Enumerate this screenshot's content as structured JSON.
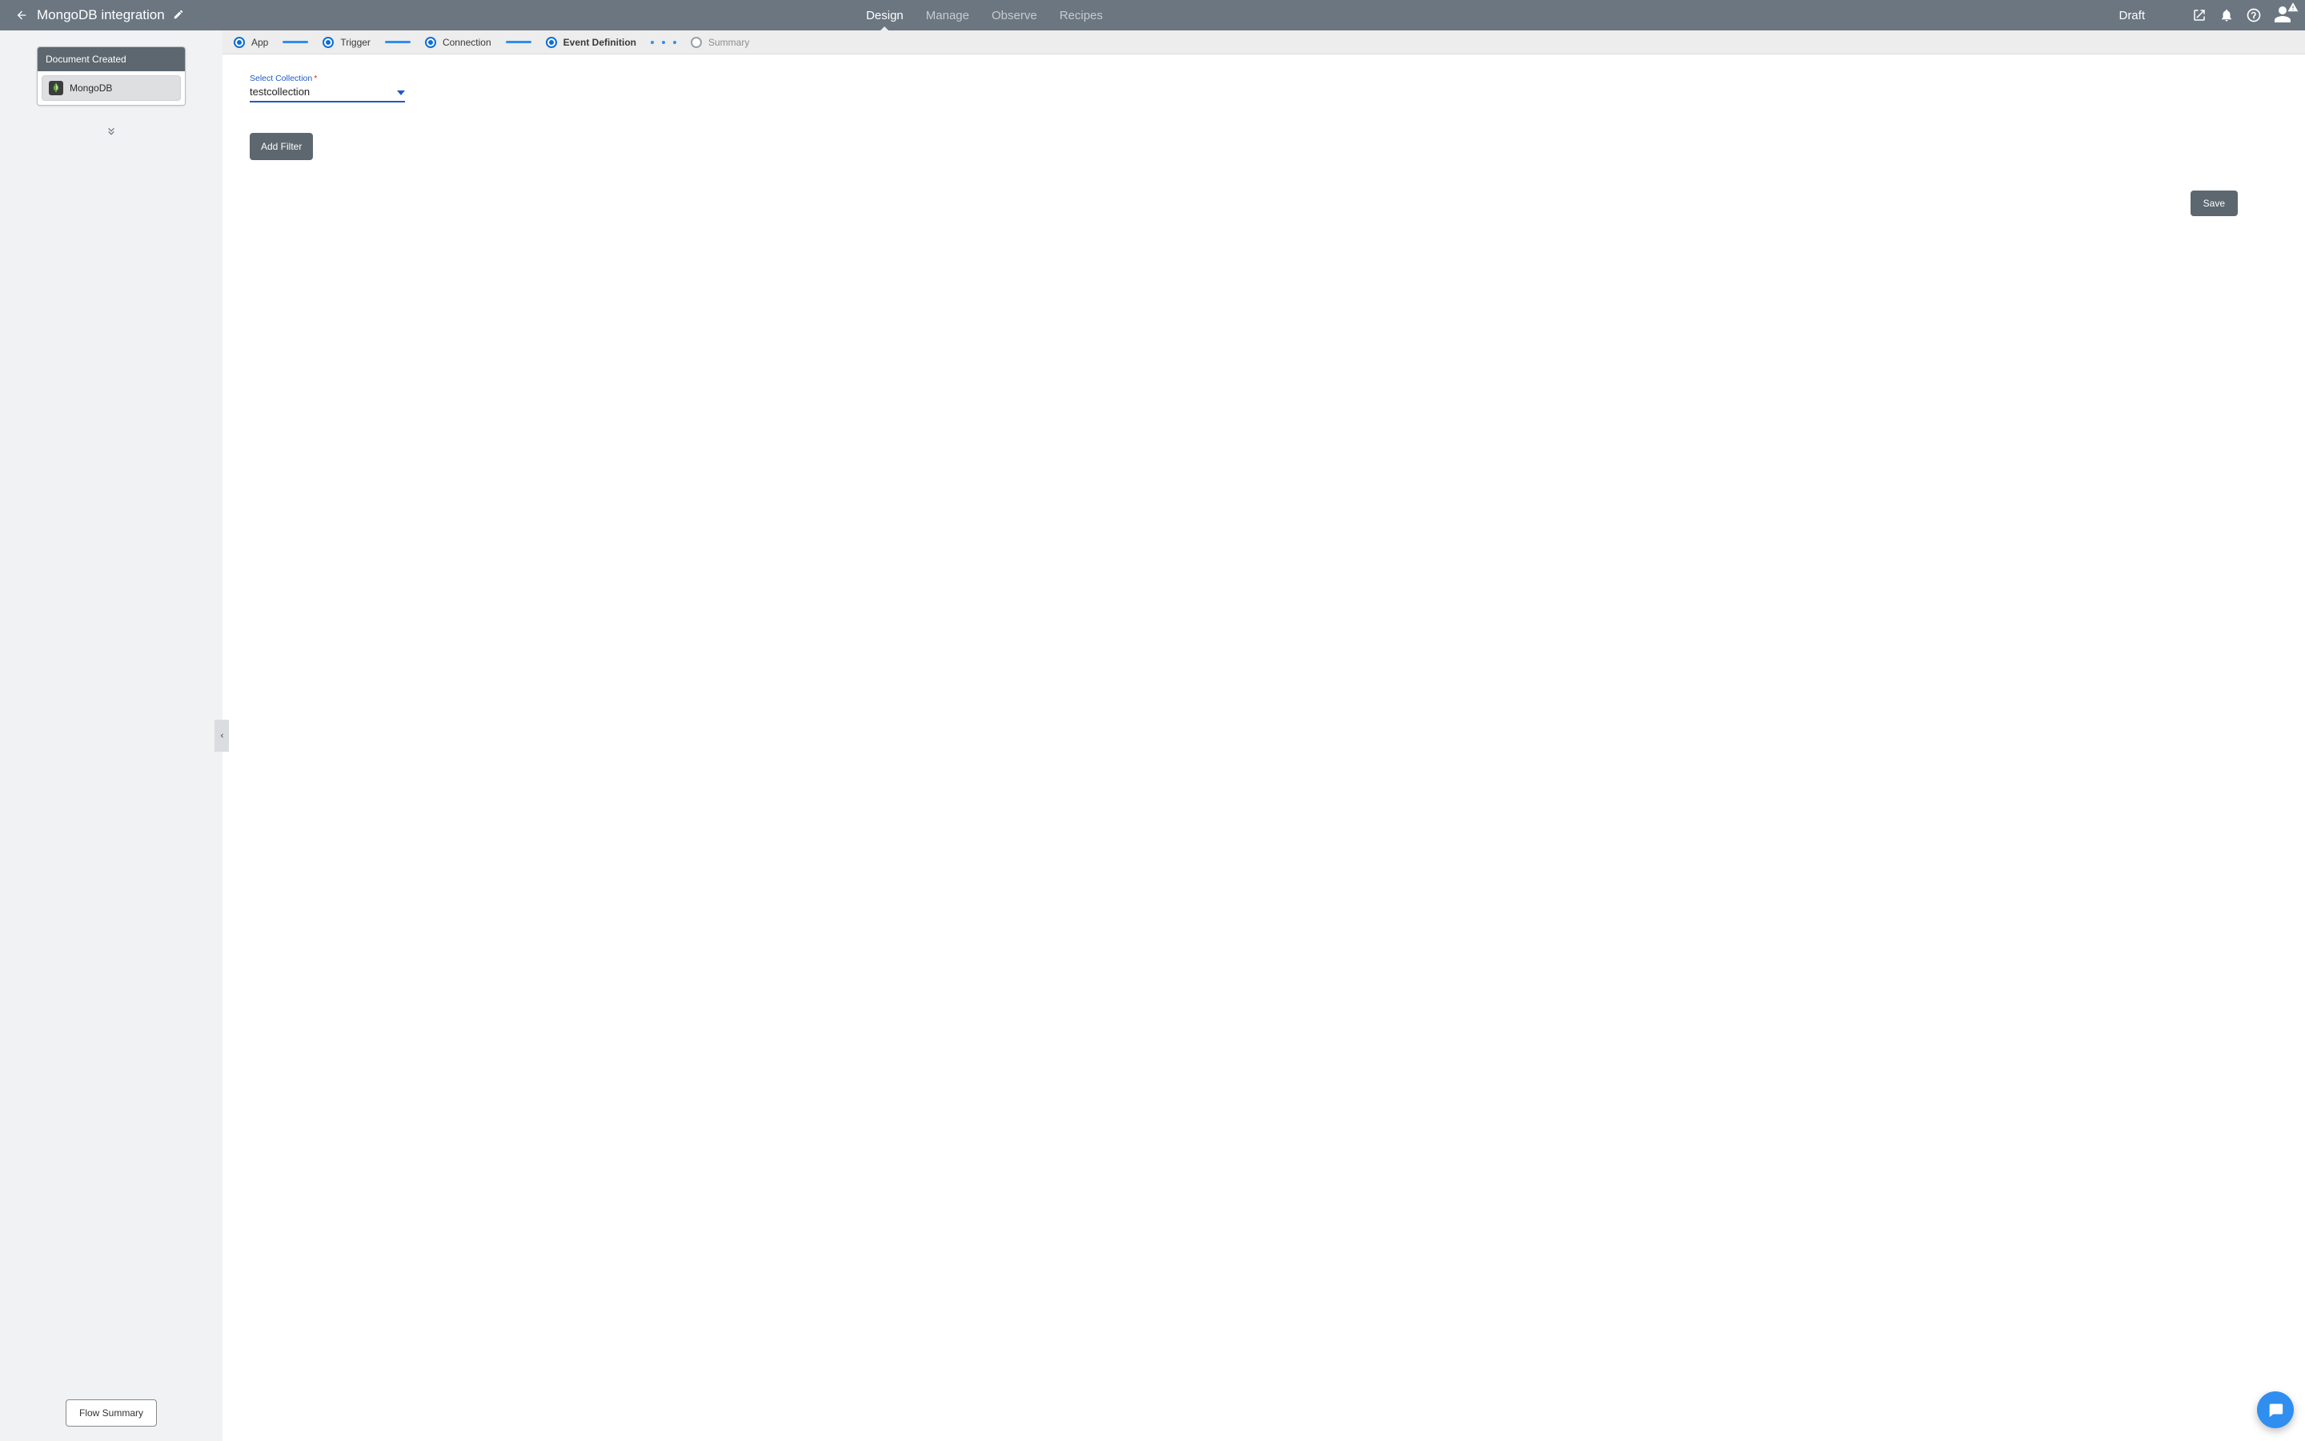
{
  "header": {
    "title": "MongoDB integration",
    "status": "Draft",
    "tabs": [
      {
        "label": "Design",
        "active": true
      },
      {
        "label": "Manage",
        "active": false
      },
      {
        "label": "Observe",
        "active": false
      },
      {
        "label": "Recipes",
        "active": false
      }
    ]
  },
  "sidebar": {
    "card_title": "Document Created",
    "app_name": "MongoDB",
    "flow_summary_label": "Flow Summary"
  },
  "stepper": {
    "steps": [
      {
        "label": "App",
        "state": "done"
      },
      {
        "label": "Trigger",
        "state": "done"
      },
      {
        "label": "Connection",
        "state": "done"
      },
      {
        "label": "Event Definition",
        "state": "current"
      },
      {
        "label": "Summary",
        "state": "pending"
      }
    ]
  },
  "form": {
    "collection_field": {
      "label": "Select Collection",
      "required": true,
      "value": "testcollection"
    },
    "add_filter_label": "Add Filter",
    "save_label": "Save"
  }
}
